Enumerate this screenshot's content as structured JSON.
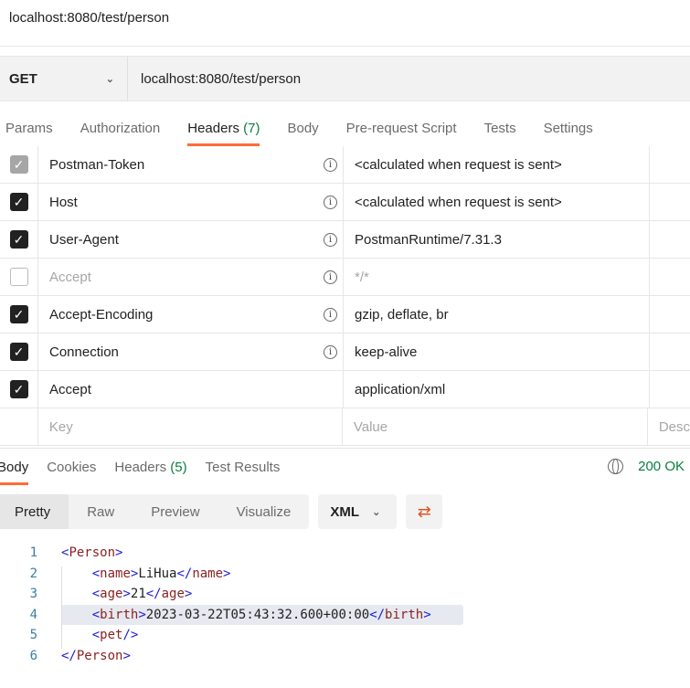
{
  "title": "localhost:8080/test/person",
  "request": {
    "method": "GET",
    "url": "localhost:8080/test/person"
  },
  "tabs": [
    {
      "label": "Params"
    },
    {
      "label": "Authorization"
    },
    {
      "label": "Headers",
      "count": "(7)"
    },
    {
      "label": "Body"
    },
    {
      "label": "Pre-request Script"
    },
    {
      "label": "Tests"
    },
    {
      "label": "Settings"
    }
  ],
  "headers": [
    {
      "key": "Postman-Token",
      "value": "<calculated when request is sent>",
      "state": "locked"
    },
    {
      "key": "Host",
      "value": "<calculated when request is sent>",
      "state": "checked"
    },
    {
      "key": "User-Agent",
      "value": "PostmanRuntime/7.31.3",
      "state": "checked"
    },
    {
      "key": "Accept",
      "value": "*/*",
      "state": "unchecked"
    },
    {
      "key": "Accept-Encoding",
      "value": "gzip, deflate, br",
      "state": "checked"
    },
    {
      "key": "Connection",
      "value": "keep-alive",
      "state": "checked"
    },
    {
      "key": "Accept",
      "value": "application/xml",
      "state": "checked"
    }
  ],
  "placeholders": {
    "key": "Key",
    "value": "Value",
    "desc": "Desc"
  },
  "response": {
    "tabs": [
      {
        "label": "Body"
      },
      {
        "label": "Cookies"
      },
      {
        "label": "Headers",
        "count": "(5)"
      },
      {
        "label": "Test Results"
      }
    ],
    "status": "200 OK",
    "views": [
      "Pretty",
      "Raw",
      "Preview",
      "Visualize"
    ],
    "format": "XML",
    "lines": [
      "1",
      "2",
      "3",
      "4",
      "5",
      "6"
    ],
    "code": {
      "person": "Person",
      "name_tag": "name",
      "name": "LiHua",
      "age_tag": "age",
      "age": "21",
      "birth_tag": "birth",
      "birth": "2023-03-22T05:43:32.600+00:00",
      "pet_tag": "pet"
    }
  },
  "colors": {
    "accent": "#ff6c37",
    "success": "#0a7e3f"
  }
}
